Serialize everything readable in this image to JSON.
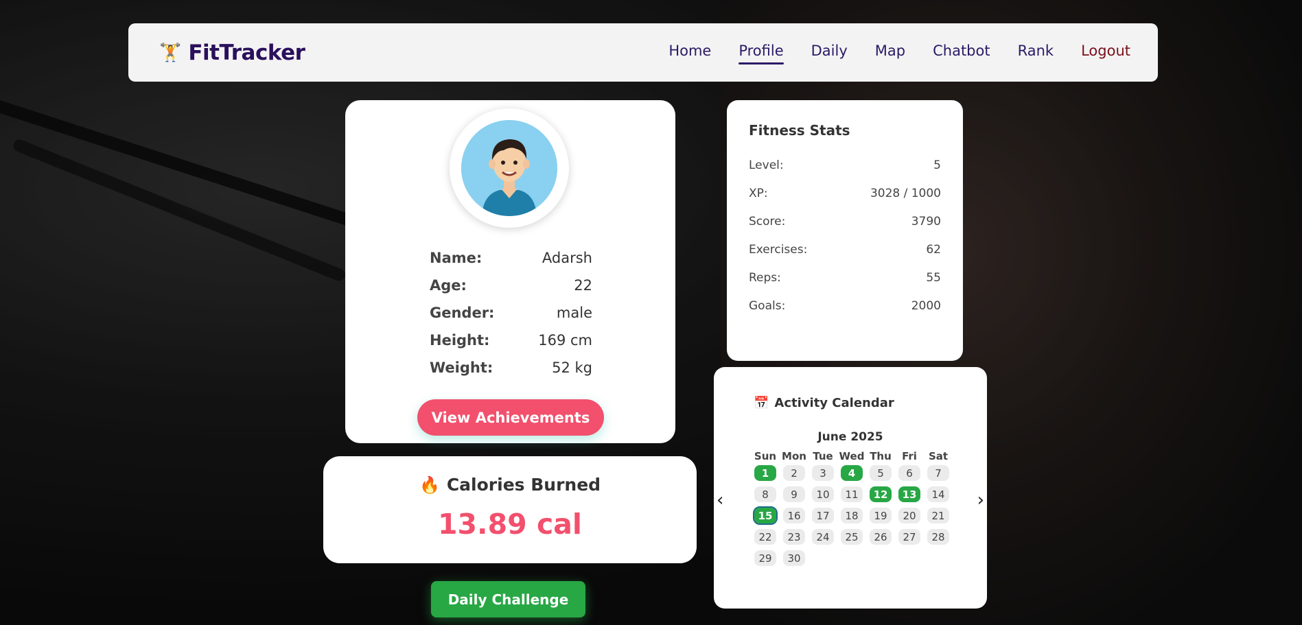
{
  "navbar": {
    "brand_icon": "🏋️",
    "brand_name": "FitTracker",
    "links": [
      "Home",
      "Profile",
      "Daily",
      "Map",
      "Chatbot",
      "Rank",
      "Logout"
    ],
    "active": "Profile"
  },
  "profile": {
    "avatar_icon": "avatar-icon",
    "rows": [
      {
        "label": "Name:",
        "value": "Adarsh"
      },
      {
        "label": "Age:",
        "value": "22"
      },
      {
        "label": "Gender:",
        "value": "male"
      },
      {
        "label": "Height:",
        "value": "169 cm"
      },
      {
        "label": "Weight:",
        "value": "52 kg"
      }
    ],
    "achievements_button": "View Achievements"
  },
  "calories": {
    "icon": "🔥",
    "title": "Calories Burned",
    "value": "13.89 cal"
  },
  "daily_challenge_button": "Daily Challenge",
  "stats": {
    "title": "Fitness Stats",
    "rows": [
      {
        "label": "Level:",
        "value": "5"
      },
      {
        "label": "XP:",
        "value": "3028 / 1000"
      },
      {
        "label": "Score:",
        "value": "3790"
      },
      {
        "label": "Exercises:",
        "value": "62"
      },
      {
        "label": "Reps:",
        "value": "55"
      },
      {
        "label": "Goals:",
        "value": "2000"
      }
    ]
  },
  "calendar": {
    "icon": "📅",
    "title": "Activity Calendar",
    "month": "June 2025",
    "prev": "‹",
    "next": "›",
    "weekdays": [
      "Sun",
      "Mon",
      "Tue",
      "Wed",
      "Thu",
      "Fri",
      "Sat"
    ],
    "weeks": [
      [
        "1",
        "2",
        "3",
        "4",
        "5",
        "6",
        "7"
      ],
      [
        "8",
        "9",
        "10",
        "11",
        "12",
        "13",
        "14"
      ],
      [
        "15",
        "16",
        "17",
        "18",
        "19",
        "20",
        "21"
      ],
      [
        "22",
        "23",
        "24",
        "25",
        "26",
        "27",
        "28"
      ],
      [
        "29",
        "30",
        "",
        "",
        "",
        "",
        ""
      ]
    ],
    "active_days": [
      "1",
      "4",
      "12",
      "13",
      "15"
    ],
    "today": "15"
  },
  "colors": {
    "accent_pink": "#f2506d",
    "accent_green": "#28a745",
    "nav_text": "#2a1a66",
    "brand": "#2a0f5c"
  }
}
